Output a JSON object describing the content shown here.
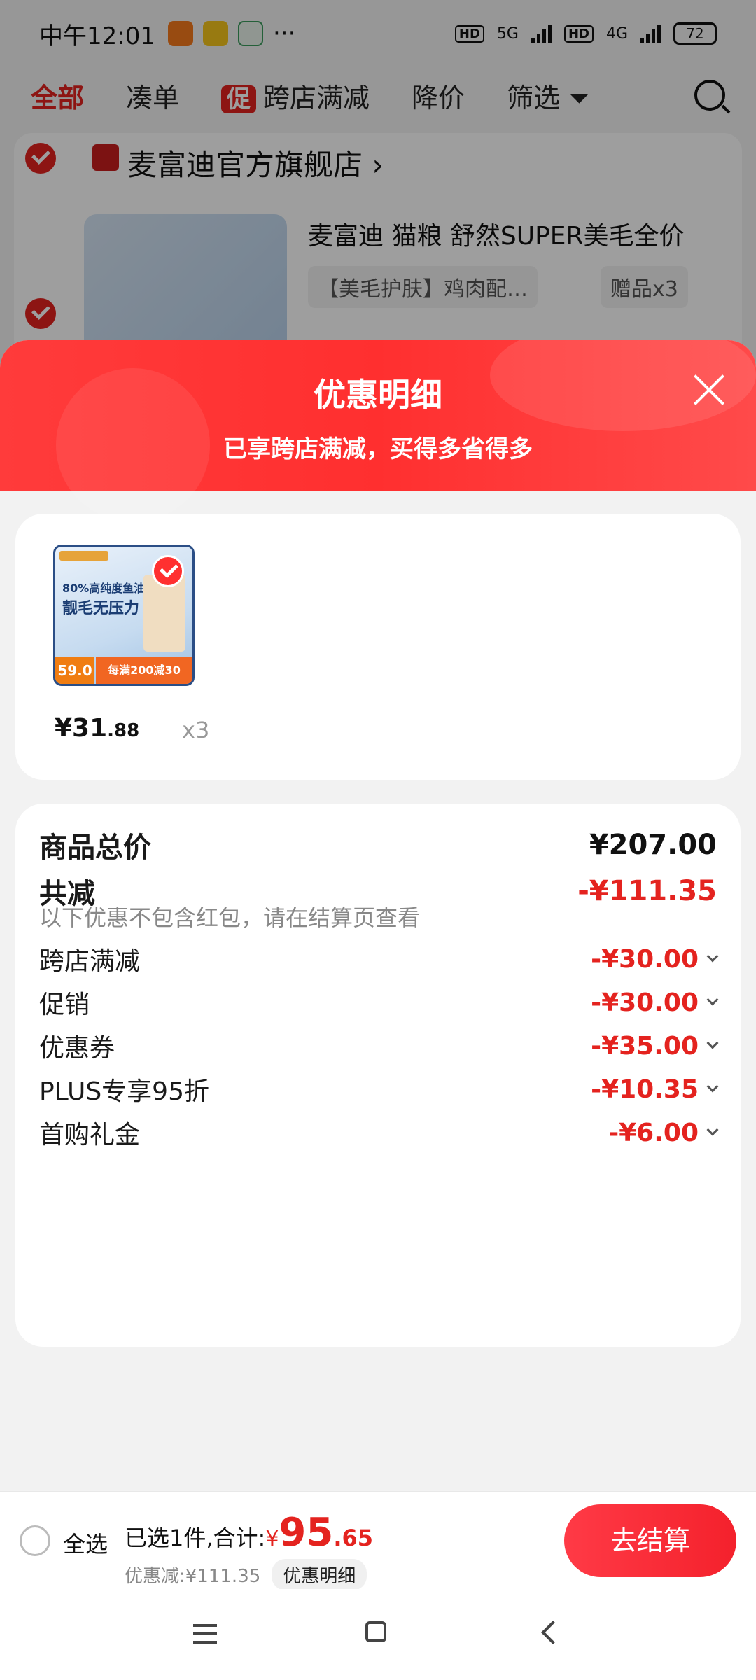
{
  "status_bar": {
    "time": "中午12:01",
    "more": "···",
    "hd1": "HD",
    "net1": "5G",
    "hd2": "HD",
    "net2": "4G",
    "battery": "72"
  },
  "tabs": {
    "all": "全部",
    "bundle": "凑单",
    "promo_tag": "促",
    "cross_store": "跨店满减",
    "price_drop": "降价",
    "filter": "筛选"
  },
  "background_store": {
    "name": "麦富迪官方旗舰店",
    "product_title": "麦富迪 猫粮 舒然SUPER美毛全价",
    "spec": "【美毛护肤】鸡肉配…",
    "gift": "赠品x3"
  },
  "sheet": {
    "title": "优惠明细",
    "subtitle": "已享跨店满减，买得多省得多"
  },
  "goods": {
    "image_line1": "80%高纯度鱼油",
    "image_line2": "靓毛无压力",
    "image_price": "59.0",
    "image_promo": "每满200减30",
    "price_int": "¥31",
    "price_dec": ".88",
    "qty": "x3"
  },
  "details": {
    "total_label": "商品总价",
    "total_value": "¥207.00",
    "reduce_label": "共减",
    "reduce_value": "-¥111.35",
    "note": "以下优惠不包含红包，请在结算页查看",
    "items": [
      {
        "label": "跨店满减",
        "value": "-¥30.00"
      },
      {
        "label": "促销",
        "value": "-¥30.00"
      },
      {
        "label": "优惠券",
        "value": "-¥35.00"
      },
      {
        "label": "PLUS专享95折",
        "value": "-¥10.35"
      },
      {
        "label": "首购礼金",
        "value": "-¥6.00"
      }
    ]
  },
  "bottom_bar": {
    "select_all": "全选",
    "summary_prefix": "已选1件,合计:",
    "yen": "¥",
    "total_int": "95",
    "total_dec": ".65",
    "saved": "优惠减:¥111.35",
    "detail_chip": "优惠明细",
    "checkout": "去结算"
  },
  "colors": {
    "accent": "#e4231f",
    "header_red": "#ff3030",
    "checkout_red": "#f4212c"
  }
}
